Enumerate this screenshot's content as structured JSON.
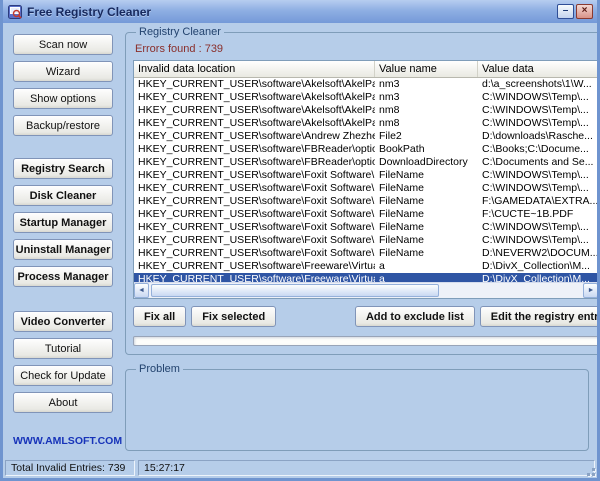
{
  "window": {
    "title": "Free Registry Cleaner",
    "controls": {
      "minimize": "–",
      "close": "×"
    }
  },
  "sidebar": {
    "groups": [
      {
        "items": [
          {
            "label": "Scan now",
            "bold": false
          },
          {
            "label": "Wizard",
            "bold": false
          },
          {
            "label": "Show options",
            "bold": false
          },
          {
            "label": "Backup/restore",
            "bold": false
          }
        ]
      },
      {
        "items": [
          {
            "label": "Registry Search",
            "bold": true
          },
          {
            "label": "Disk Cleaner",
            "bold": true
          },
          {
            "label": "Startup Manager",
            "bold": true
          },
          {
            "label": "Uninstall Manager",
            "bold": true
          },
          {
            "label": "Process Manager",
            "bold": true
          }
        ]
      },
      {
        "items": [
          {
            "label": "Video Converter",
            "bold": true
          },
          {
            "label": "Tutorial",
            "bold": false
          },
          {
            "label": "Check for Update",
            "bold": false
          },
          {
            "label": "About",
            "bold": false
          }
        ]
      }
    ],
    "website": "WWW.AMLSOFT.COM"
  },
  "main": {
    "group_title": "Registry Cleaner",
    "errors_found": "Errors found : 739",
    "table": {
      "columns": [
        "Invalid data location",
        "Value name",
        "Value data"
      ],
      "rows": [
        {
          "location": "HKEY_CURRENT_USER\\software\\Akelsoft\\AkelPad\\R...",
          "name": "nm3",
          "data": "d:\\a_screenshots\\1\\W...",
          "selected": false
        },
        {
          "location": "HKEY_CURRENT_USER\\software\\Akelsoft\\AkelPad\\R...",
          "name": "nm3",
          "data": "C:\\WINDOWS\\Temp\\...",
          "selected": false
        },
        {
          "location": "HKEY_CURRENT_USER\\software\\Akelsoft\\AkelPad\\R...",
          "name": "nm8",
          "data": "C:\\WINDOWS\\Temp\\...",
          "selected": false
        },
        {
          "location": "HKEY_CURRENT_USER\\software\\Akelsoft\\AkelPad\\R...",
          "name": "nm8",
          "data": "C:\\WINDOWS\\Temp\\...",
          "selected": false
        },
        {
          "location": "HKEY_CURRENT_USER\\software\\Andrew Zhezherun\\...",
          "name": "File2",
          "data": "D:\\downloads\\Rasche...",
          "selected": false
        },
        {
          "location": "HKEY_CURRENT_USER\\software\\FBReader\\options\\...",
          "name": "BookPath",
          "data": "C:\\Books;C:\\Docume...",
          "selected": false
        },
        {
          "location": "HKEY_CURRENT_USER\\software\\FBReader\\options\\...",
          "name": "DownloadDirectory",
          "data": "C:\\Documents and Se...",
          "selected": false
        },
        {
          "location": "HKEY_CURRENT_USER\\software\\Foxit Software\\Fox...",
          "name": "FileName",
          "data": "C:\\WINDOWS\\Temp\\...",
          "selected": false
        },
        {
          "location": "HKEY_CURRENT_USER\\software\\Foxit Software\\Fox...",
          "name": "FileName",
          "data": "C:\\WINDOWS\\Temp\\...",
          "selected": false
        },
        {
          "location": "HKEY_CURRENT_USER\\software\\Foxit Software\\Fox...",
          "name": "FileName",
          "data": "F:\\GAMEDATA\\EXTRA...",
          "selected": false
        },
        {
          "location": "HKEY_CURRENT_USER\\software\\Foxit Software\\Fox...",
          "name": "FileName",
          "data": "F:\\CUCTE~1B.PDF",
          "selected": false
        },
        {
          "location": "HKEY_CURRENT_USER\\software\\Foxit Software\\Fox...",
          "name": "FileName",
          "data": "C:\\WINDOWS\\Temp\\...",
          "selected": false
        },
        {
          "location": "HKEY_CURRENT_USER\\software\\Foxit Software\\Fox...",
          "name": "FileName",
          "data": "C:\\WINDOWS\\Temp\\...",
          "selected": false
        },
        {
          "location": "HKEY_CURRENT_USER\\software\\Foxit Software\\Fox...",
          "name": "FileName",
          "data": "D:\\NEVERW2\\DOCUM...",
          "selected": false
        },
        {
          "location": "HKEY_CURRENT_USER\\software\\Freeware\\VirtualDu...",
          "name": "a",
          "data": "D:\\DivX_Collection\\M...",
          "selected": false
        },
        {
          "location": "HKEY_CURRENT_USER\\software\\Freeware\\VirtualDu...",
          "name": "a",
          "data": "D:\\DivX_Collection\\M...",
          "selected": true
        }
      ]
    },
    "action_buttons": [
      {
        "label": "Fix all"
      },
      {
        "label": "Fix selected"
      },
      {
        "label": "Add to exclude list"
      },
      {
        "label": "Edit the registry entry"
      }
    ],
    "problem_group_title": "Problem"
  },
  "statusbar": {
    "total_invalid": "Total Invalid Entries: 739",
    "time": "15:27:17"
  }
}
